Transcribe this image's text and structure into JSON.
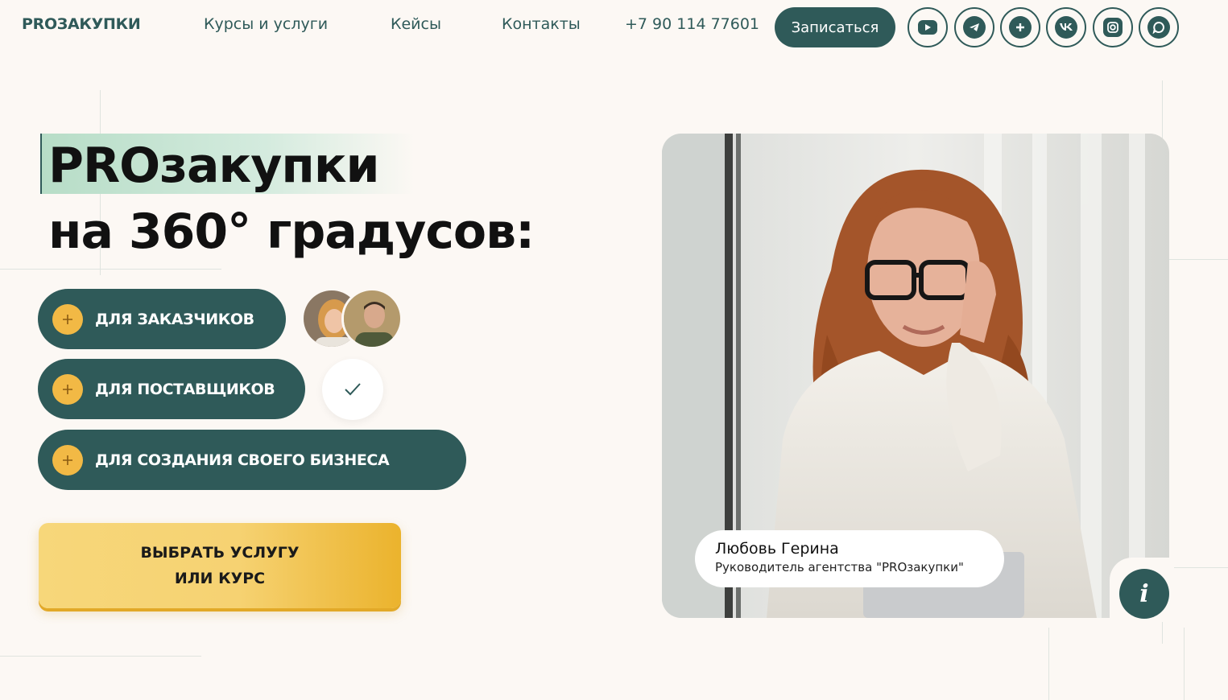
{
  "header": {
    "logo": "PROЗАКУПКИ",
    "nav": [
      "Курсы и услуги",
      "Кейсы",
      "Контакты"
    ],
    "phone": "+7 90 114 77601",
    "signup_label": "Записаться",
    "socials": [
      "youtube-icon",
      "telegram-icon",
      "rutube-icon",
      "vk-icon",
      "instagram-icon",
      "chat-icon"
    ]
  },
  "hero": {
    "title_line1": "PROзакупки",
    "title_line2": "на 360° градусов:",
    "pills": [
      "ДЛЯ ЗАКАЗЧИКОВ",
      "ДЛЯ ПОСТАВЩИКОВ",
      "ДЛЯ СОЗДАНИЯ СВОЕГО БИЗНЕСА"
    ],
    "cta_line1": "ВЫБРАТЬ УСЛУГУ",
    "cta_line2": "ИЛИ КУРС"
  },
  "person": {
    "name": "Любовь Герина",
    "role": "Руководитель агентства \"PROзакупки\""
  },
  "info_label": "i",
  "colors": {
    "primary": "#2f5a59",
    "accent": "#f2b945",
    "background": "#fcf8f4"
  }
}
